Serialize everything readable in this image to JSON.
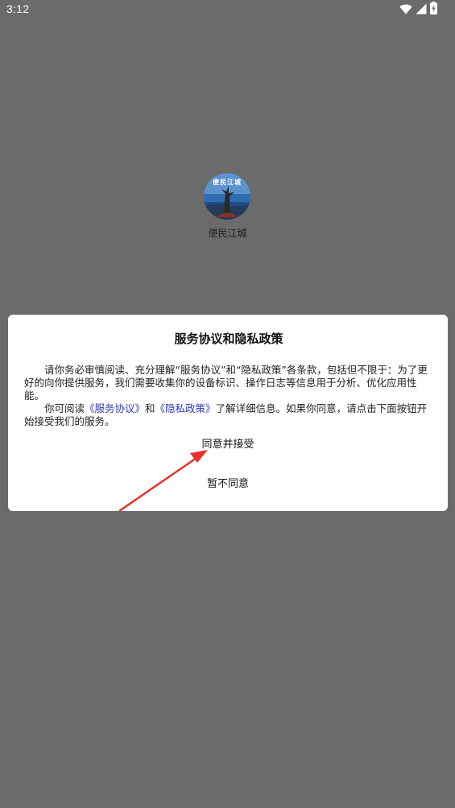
{
  "status_bar": {
    "time": "3:12"
  },
  "app": {
    "logo_text": "便民江城",
    "name": "便民江城"
  },
  "dialog": {
    "title": "服务协议和隐私政策",
    "paragraph1": "请你务必审慎阅读、充分理解“服务协议”和“隐私政策”各条款，包括但不限于：为了更好的向你提供服务，我们需要收集你的设备标识、操作日志等信息用于分析、优化应用性能。",
    "paragraph2": {
      "prefix": "你可阅读",
      "link_service": "《服务协议》",
      "middle": "和",
      "link_privacy": "《隐私政策》",
      "suffix": "了解详细信息。如果你同意，请点击下面按钮开始接受我们的服务。"
    },
    "agree_button": "同意并接受",
    "disagree_button": "暂不同意"
  },
  "colors": {
    "background_overlay": "#6b6b6b",
    "dialog_background": "#ffffff",
    "link": "#2b3ab8",
    "annotation_arrow": "#e8302a"
  },
  "icons": {
    "status": [
      "wifi-icon",
      "signal-icon",
      "battery-charging-icon"
    ]
  }
}
